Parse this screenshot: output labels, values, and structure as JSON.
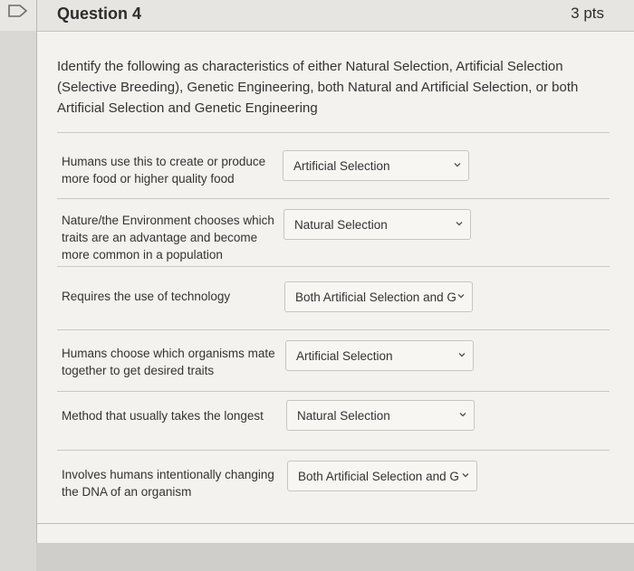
{
  "question": {
    "title": "Question 4",
    "points": "3 pts",
    "prompt": "Identify the following as characteristics of either Natural Selection, Artificial Selection (Selective Breeding), Genetic Engineering, both Natural and Artificial Selection, or both Artificial Selection and Genetic Engineering"
  },
  "matches": [
    {
      "label": "Humans use this to create or produce more food or higher quality food",
      "answer": "Artificial Selection"
    },
    {
      "label": "Nature/the Environment chooses which traits are an advantage and become more common in a population",
      "answer": "Natural Selection"
    },
    {
      "label": "Requires the use of technology",
      "answer": "Both Artificial Selection and G"
    },
    {
      "label": "Humans choose which organisms mate together to get desired traits",
      "answer": "Artificial Selection"
    },
    {
      "label": "Method that usually takes the longest",
      "answer": "Natural Selection"
    },
    {
      "label": "Involves humans intentionally changing the DNA of an organism",
      "answer": "Both Artificial Selection and G"
    }
  ],
  "icons": {
    "flag": "bookmark-flag-icon",
    "chevron": "chevron-down-icon"
  },
  "colors": {
    "background": "#f3f2ee",
    "header": "#e6e5e1",
    "border": "#c6c5c0"
  }
}
